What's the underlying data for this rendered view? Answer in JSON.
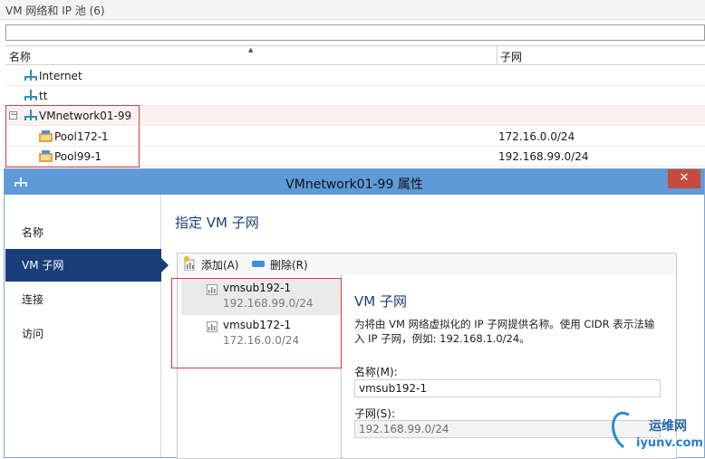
{
  "panel": {
    "title": "VM 网络和 IP 池 (6)"
  },
  "grid": {
    "columns": {
      "name": "名称",
      "subnet": "子网"
    },
    "rows": [
      {
        "name": "Internet",
        "subnet": "",
        "icon": "network-icon"
      },
      {
        "name": "tt",
        "subnet": "",
        "icon": "network-icon"
      },
      {
        "name": "VMnetwork01-99",
        "subnet": "",
        "icon": "network-icon",
        "expander": "⊟"
      },
      {
        "name": "Pool172-1",
        "subnet": "172.16.0.0/24",
        "icon": "ip-pool-icon"
      },
      {
        "name": "Pool99-1",
        "subnet": "192.168.99.0/24",
        "icon": "ip-pool-icon"
      }
    ]
  },
  "dialog": {
    "title": "VMnetwork01-99 属性",
    "close": "✕",
    "nav": [
      {
        "label": "名称"
      },
      {
        "label": "VM 子网"
      },
      {
        "label": "连接"
      },
      {
        "label": "访问"
      }
    ],
    "heading": "指定 VM 子网",
    "toolbar": {
      "add": "添加(A)",
      "remove": "删除(R)"
    },
    "subnets": [
      {
        "name": "vmsub192-1",
        "addr": "192.168.99.0/24"
      },
      {
        "name": "vmsub172-1",
        "addr": "172.16.0.0/24"
      }
    ],
    "detail": {
      "title": "VM 子网",
      "desc": "为将由 VM 网络虚拟化的 IP 子网提供名称。使用 CIDR 表示法输入 IP 子网，例如: 192.168.1.0/24。",
      "name_label": "名称(M):",
      "name_value": "vmsub192-1",
      "subnet_label": "子网(S):",
      "subnet_value": "192.168.99.0/24"
    }
  },
  "watermark": {
    "cn": "运维网",
    "en": "iyunv.com"
  },
  "colors": {
    "titlebar": "#5e9ad8",
    "nav_active": "#1b3d7a",
    "highlight_box": "#d83a3a",
    "heading": "#1c3f76"
  }
}
